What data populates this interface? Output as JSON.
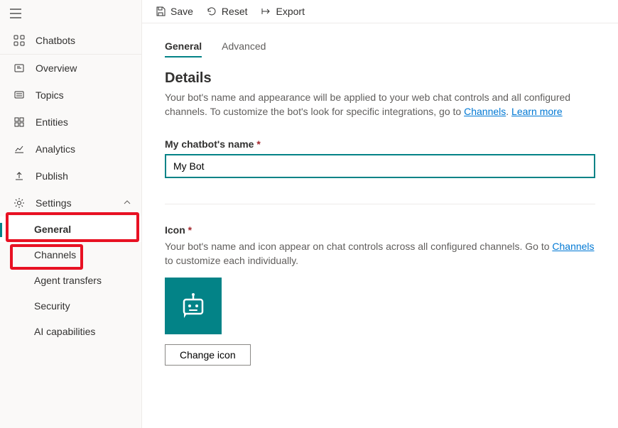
{
  "toolbar": {
    "save_label": "Save",
    "reset_label": "Reset",
    "export_label": "Export"
  },
  "sidebar": {
    "chatbots": "Chatbots",
    "overview": "Overview",
    "topics": "Topics",
    "entities": "Entities",
    "analytics": "Analytics",
    "publish": "Publish",
    "settings": "Settings",
    "general": "General",
    "channels": "Channels",
    "agent_transfers": "Agent transfers",
    "security": "Security",
    "ai_capabilities": "AI capabilities"
  },
  "tabs": {
    "general": "General",
    "advanced": "Advanced"
  },
  "details": {
    "title": "Details",
    "desc_prefix": "Your bot's name and appearance will be applied to your web chat controls and all configured channels. To customize the bot's look for specific integrations, go to ",
    "channels_link": "Channels",
    "sep": ". ",
    "learn_more": "Learn more"
  },
  "name_field": {
    "label": "My chatbot's name",
    "value": "My Bot"
  },
  "icon_field": {
    "label": "Icon",
    "desc_prefix": "Your bot's name and icon appear on chat controls across all configured channels. Go to ",
    "channels_link": "Channels",
    "desc_suffix": " to customize each individually.",
    "change_btn": "Change icon"
  }
}
